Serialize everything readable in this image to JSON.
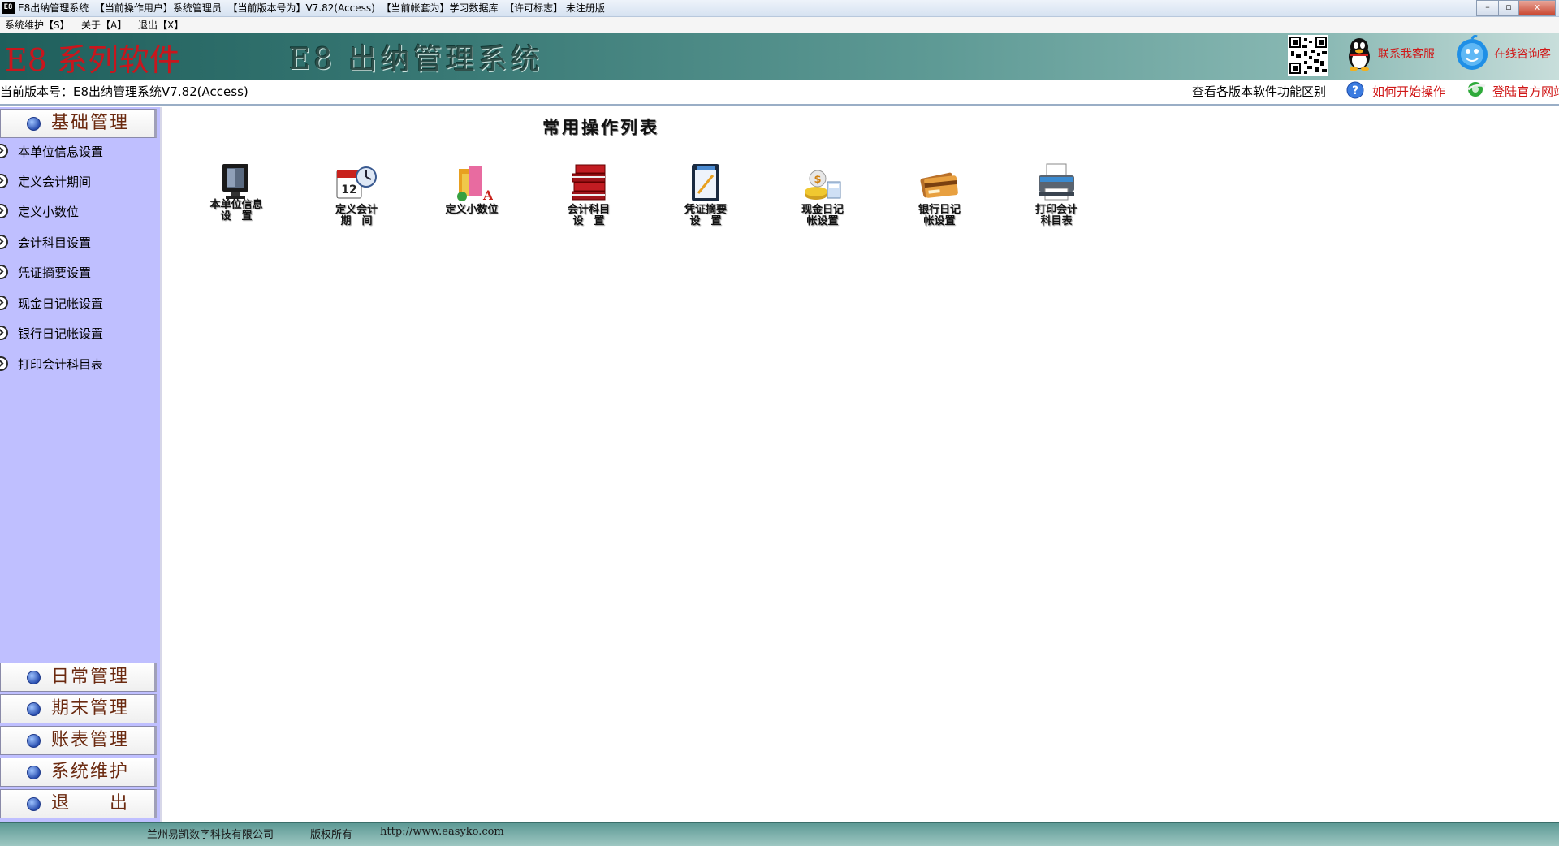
{
  "window": {
    "icon_text": "E8",
    "title": "E8出纳管理系统  【当前操作用户】系统管理员  【当前版本号为】V7.82(Access)  【当前帐套为】学习数据库  【许可标志】 未注册版",
    "minimize": "–",
    "restore": "▫",
    "close": "x"
  },
  "menu": [
    "系统维护【S】",
    "关于【A】",
    "退出【X】"
  ],
  "banner": {
    "brand": "E8 系列软件",
    "system_title": "E8 出纳管理系统",
    "qq_label": "联系我客服",
    "blue_label": "在线咨询客"
  },
  "version_bar": {
    "version": "当前版本号：E8出纳管理系统V7.82(Access)",
    "compare": "查看各版本软件功能区别",
    "help": "如何开始操作",
    "website": "登陆官方网站"
  },
  "sidebar": {
    "sections": [
      "基础管理",
      "日常管理",
      "期末管理",
      "账表管理",
      "系统维护",
      "退　　出"
    ],
    "items": [
      "本单位信息设置",
      "定义会计期间",
      "定义小数位",
      "会计科目设置",
      "凭证摘要设置",
      "现金日记帐设置",
      "银行日记帐设置",
      "打印会计科目表"
    ]
  },
  "main": {
    "title": "常用操作列表",
    "ops": [
      {
        "label": "本单位信息\n设　置",
        "icon": "monitor-icon"
      },
      {
        "label": "定义会计\n期　间",
        "icon": "calendar-clock-icon"
      },
      {
        "label": "定义小数位",
        "icon": "books-icon"
      },
      {
        "label": "会计科目\n设　置",
        "icon": "red-books-icon"
      },
      {
        "label": "凭证摘要\n设　置",
        "icon": "notepad-icon"
      },
      {
        "label": "现金日记\n帐设置",
        "icon": "coins-icon"
      },
      {
        "label": "银行日记\n帐设置",
        "icon": "bank-cards-icon"
      },
      {
        "label": "打印会计\n科目表",
        "icon": "printer-icon"
      }
    ]
  },
  "footer": {
    "company": "兰州易凯数字科技有限公司",
    "rights": "版权所有",
    "url": "http://www.easyko.com"
  },
  "colors": {
    "banner": "#3a7a76",
    "sidebar": "#bfbfff",
    "accent_red": "#d01818"
  }
}
